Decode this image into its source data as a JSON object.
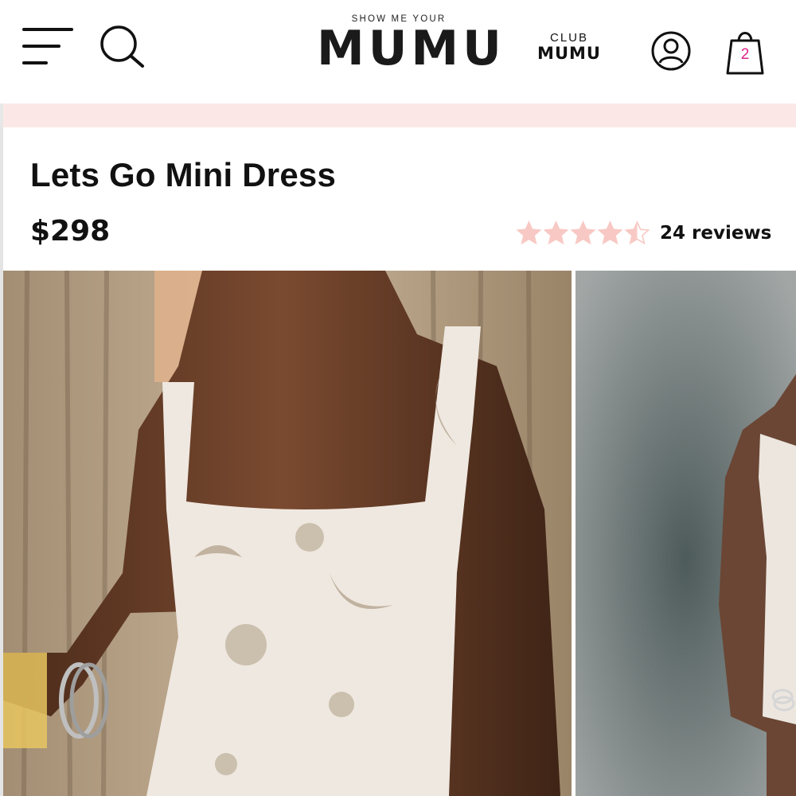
{
  "header": {
    "brand_small": "SHOW ME YOUR",
    "brand_big": "MUMU",
    "club_small": "CLUB",
    "club_big": "MUMU",
    "cart_count": "2",
    "icons": [
      "menu-icon",
      "search-icon",
      "account-icon",
      "cart-bag-icon"
    ]
  },
  "product": {
    "title": "Lets Go Mini Dress",
    "price": "$298",
    "rating": 4.5,
    "rating_max": 5,
    "reviews_label": "24 reviews"
  },
  "colors": {
    "accent_pink": "#e0218a",
    "star_pink": "#f8c9c4",
    "promo_bg": "#fbe8e6"
  }
}
